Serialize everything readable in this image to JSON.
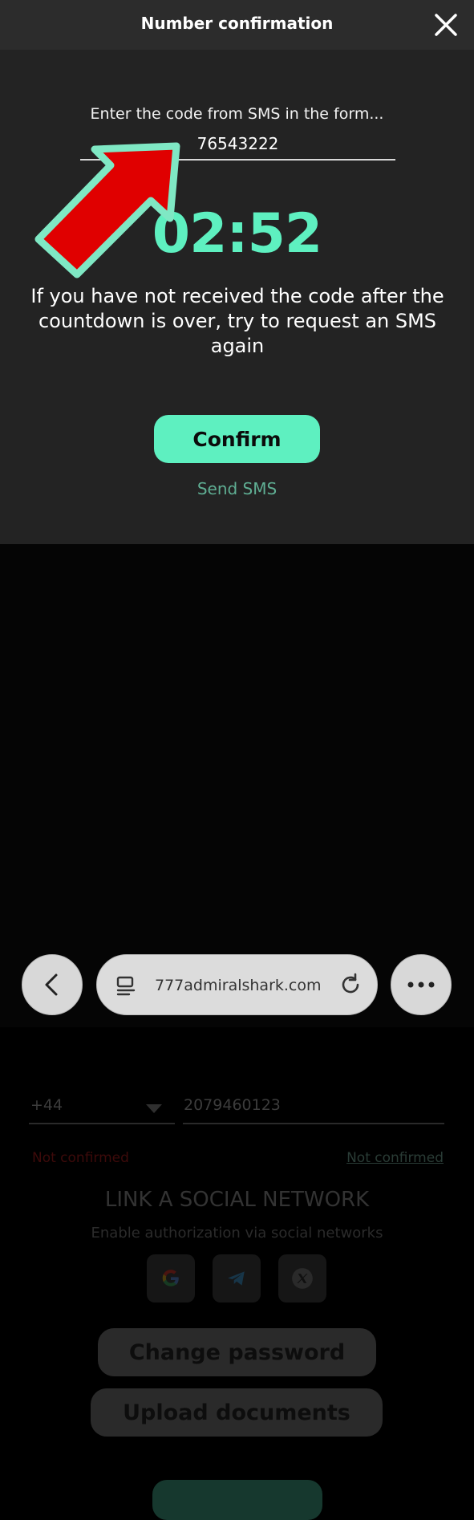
{
  "header": {
    "title": "Number confirmation"
  },
  "modal": {
    "instruction": "Enter the code from SMS in the form...",
    "code_value": "76543222",
    "timer": "02:52",
    "notice": "If you have not received the code after the countdown is over, try to request an SMS again",
    "confirm_label": "Confirm",
    "send_sms_label": "Send SMS"
  },
  "background": {
    "country_code": "+44",
    "phone": "2079460123",
    "status_red": "Not confirmed",
    "status_link": "Not confirmed",
    "social_title": "LINK A SOCIAL NETWORK",
    "social_subtitle": "Enable authorization via social networks",
    "change_password": "Change password",
    "upload_documents": "Upload documents"
  },
  "browser": {
    "url": "777admiralshark.com"
  },
  "colors": {
    "accent": "#5ef0c0",
    "modal_bg": "#232323",
    "header_bg": "#2c2c2c",
    "arrow": "#e00000"
  },
  "icons": [
    "close-icon",
    "dropdown-caret-icon",
    "google-icon",
    "telegram-icon",
    "x-icon",
    "back-arrow-icon",
    "tabs-icon",
    "reload-icon",
    "more-icon",
    "pointer-arrow-icon"
  ]
}
